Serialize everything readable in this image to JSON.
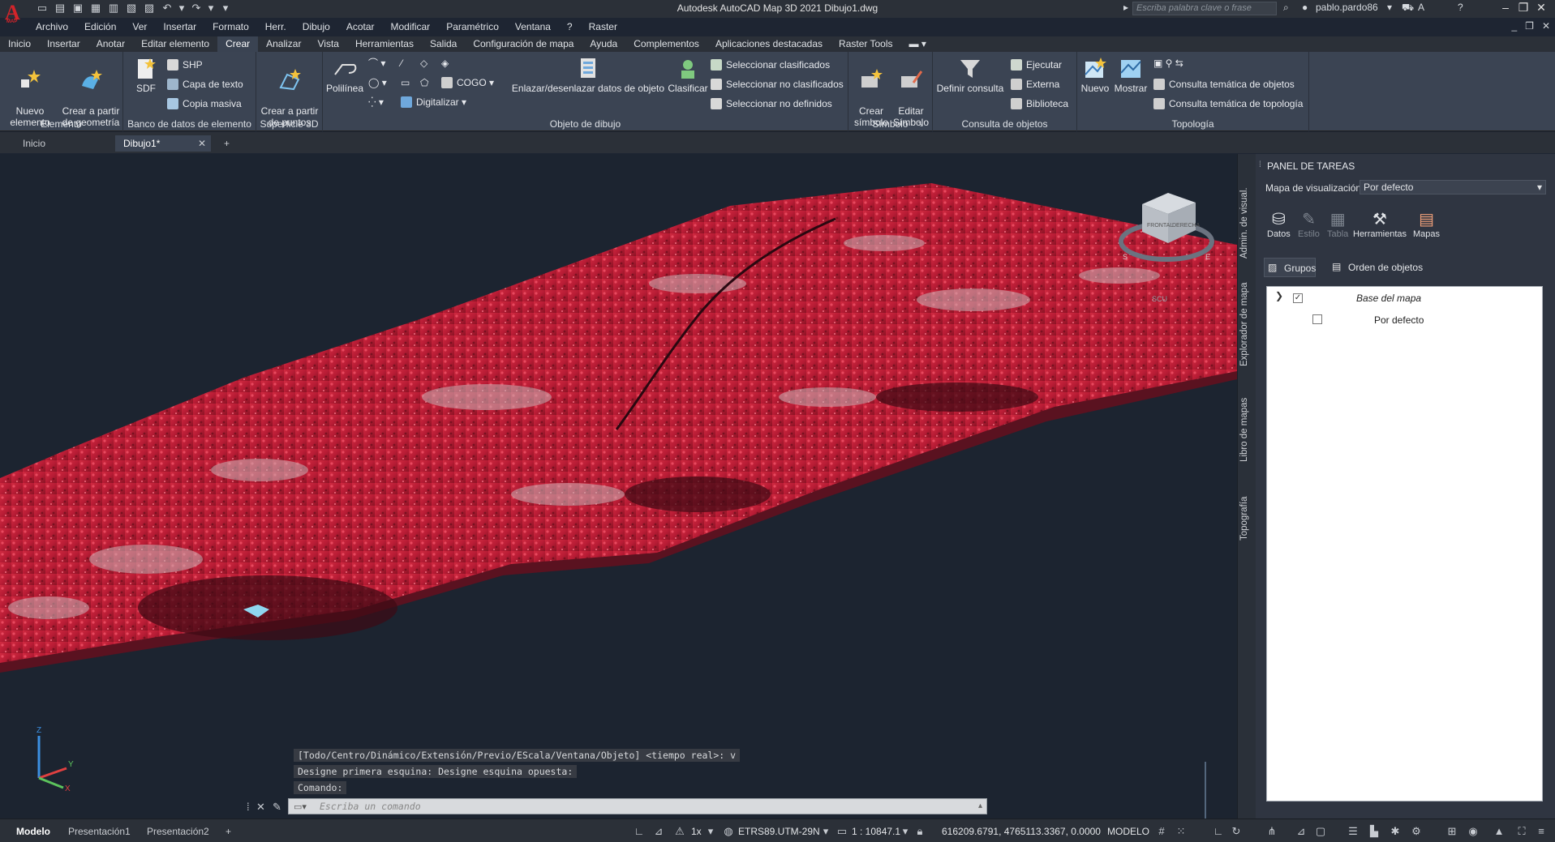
{
  "titlebar": {
    "title": "Autodesk AutoCAD Map 3D 2021    Dibujo1.dwg",
    "search_placeholder": "Escriba palabra clave o frase",
    "user": "pablo.pardo86",
    "logo": "A",
    "logo_sub": "MAP"
  },
  "menu": [
    "Archivo",
    "Edición",
    "Ver",
    "Insertar",
    "Formato",
    "Herr.",
    "Dibujo",
    "Acotar",
    "Modificar",
    "Paramétrico",
    "Ventana",
    "?",
    "Raster"
  ],
  "ribbon_tabs": [
    {
      "label": "Inicio"
    },
    {
      "label": "Insertar"
    },
    {
      "label": "Anotar"
    },
    {
      "label": "Editar elemento"
    },
    {
      "label": "Crear",
      "active": true
    },
    {
      "label": "Analizar"
    },
    {
      "label": "Vista"
    },
    {
      "label": "Herramientas"
    },
    {
      "label": "Salida"
    },
    {
      "label": "Configuración de mapa"
    },
    {
      "label": "Ayuda"
    },
    {
      "label": "Complementos"
    },
    {
      "label": "Aplicaciones destacadas"
    },
    {
      "label": "Raster Tools"
    }
  ],
  "ribbon": {
    "elemento": {
      "label": "Elemento",
      "nuevo": "Nuevo\nelemento",
      "crear_geom": "Crear a partir\nde geometría"
    },
    "banco": {
      "label": "Banco de datos de elemento",
      "sdf": "SDF",
      "shp": "SHP",
      "capa_texto": "Capa de texto",
      "copia_masiva": "Copia masiva"
    },
    "superficie": {
      "label": "Superficie 3D",
      "crear_puntos": "Crear a partir\nde puntos"
    },
    "dibujo": {
      "label": "Objeto de dibujo",
      "polilinea": "Polilínea",
      "cogo": "COGO",
      "digitalizar": "Digitalizar",
      "enlazar": "Enlazar/desenlazar datos de objeto",
      "clasificar": "Clasificar",
      "sel_clasificados": "Seleccionar clasificados",
      "sel_no_clasificados": "Seleccionar no clasificados",
      "sel_no_definidos": "Seleccionar no definidos"
    },
    "simbolo": {
      "label": "Símbolo",
      "crear": "Crear\nsímbolo",
      "editar": "Editar\nSímbolo"
    },
    "consulta": {
      "label": "Consulta de objetos",
      "definir": "Definir consulta",
      "ejecutar": "Ejecutar",
      "externa": "Externa",
      "biblioteca": "Biblioteca"
    },
    "topologia": {
      "label": "Topología",
      "nuevo": "Nuevo",
      "mostrar": "Mostrar",
      "tem_objetos": "Consulta temática de objetos",
      "tem_topologia": "Consulta temática de topología"
    }
  },
  "file_tabs": [
    {
      "label": "Inicio"
    },
    {
      "label": "Dibujo1*",
      "active": true
    }
  ],
  "viewcube": {
    "front": "FRONTAL",
    "right": "DERECHA",
    "south": "S",
    "east": "E",
    "ucs": "SCU"
  },
  "ucs_icon": {
    "x": "X",
    "y": "Y",
    "z": "Z"
  },
  "command": {
    "history": [
      "[Todo/Centro/Dinámico/Extensión/Previo/EScala/Ventana/Objeto] <tiempo real>: v",
      "Designe primera esquina: Designe esquina opuesta:",
      "Comando:"
    ],
    "placeholder": "Escriba un comando"
  },
  "taskpane": {
    "title": "PANEL DE TAREAS",
    "vertical_tabs": [
      "Admin. de visual.",
      "Explorador de mapa",
      "Libro de mapas",
      "Topografía"
    ],
    "map_label": "Mapa de visualización:",
    "map_value": "Por defecto",
    "tools": [
      "Datos",
      "Estilo",
      "Tabla",
      "Herramientas",
      "Mapas"
    ],
    "groups_label": "Grupos",
    "order_label": "Orden de objetos",
    "tree": [
      {
        "label": "Base del mapa",
        "checked": true
      },
      {
        "label": "Por defecto",
        "checked": false
      }
    ]
  },
  "statusbar": {
    "tabs": [
      {
        "label": "Modelo",
        "active": true
      },
      {
        "label": "Presentación1"
      },
      {
        "label": "Presentación2"
      }
    ],
    "zoom": "1x",
    "crs": "ETRS89.UTM-29N",
    "scale": "1 : 10847.1",
    "coords": "616209.6791, 4765113.3367, 0.0000",
    "space": "MODELO"
  }
}
